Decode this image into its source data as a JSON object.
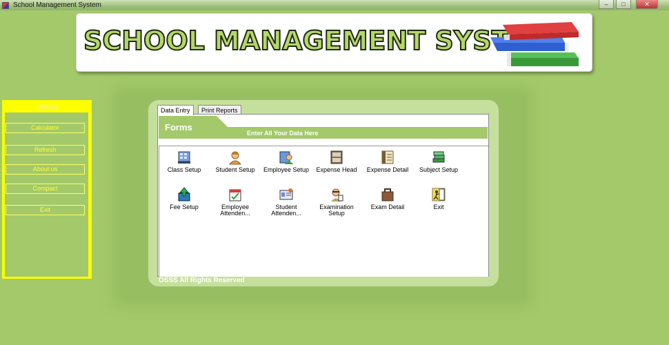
{
  "window": {
    "title": "School Management System",
    "controls": [
      "minimize",
      "maximize",
      "close"
    ]
  },
  "banner": {
    "text": "SCHOOL MANAGEMENT SYSTEM",
    "icon": "books-icon"
  },
  "sidebar": {
    "heading": "Utilties",
    "buttons": [
      "Calculator",
      "Refresh",
      "About us",
      "Compact",
      "Exit"
    ]
  },
  "tabs": [
    {
      "label": "Data Entry",
      "active": true
    },
    {
      "label": "Print Reports",
      "active": false
    }
  ],
  "forms": {
    "title": "Forms",
    "subtitle": "Enter All Your Data Here"
  },
  "items": [
    {
      "label": "Class Setup",
      "icon": "class-setup-icon"
    },
    {
      "label": "Student Setup",
      "icon": "student-setup-icon"
    },
    {
      "label": "Employee Setup",
      "icon": "employee-setup-icon"
    },
    {
      "label": "Expense Head",
      "icon": "expense-head-icon"
    },
    {
      "label": "Expense Detail",
      "icon": "expense-detail-icon"
    },
    {
      "label": "Subject Setup",
      "icon": "subject-setup-icon"
    },
    {
      "label": "Fee Setup",
      "icon": "fee-setup-icon"
    },
    {
      "label": "Employee Attenden...",
      "icon": "employee-attendance-icon"
    },
    {
      "label": "Student Attenden...",
      "icon": "student-attendance-icon"
    },
    {
      "label": "Examination Setup",
      "icon": "examination-setup-icon"
    },
    {
      "label": "Exam Detail",
      "icon": "exam-detail-icon"
    },
    {
      "label": "Exit",
      "icon": "exit-icon"
    }
  ],
  "footer": "OSSS All Rights Reserved",
  "colors": {
    "background": "#a3c96a",
    "sidebar": "#ffff00",
    "forms_bar": "#a3c96a"
  }
}
